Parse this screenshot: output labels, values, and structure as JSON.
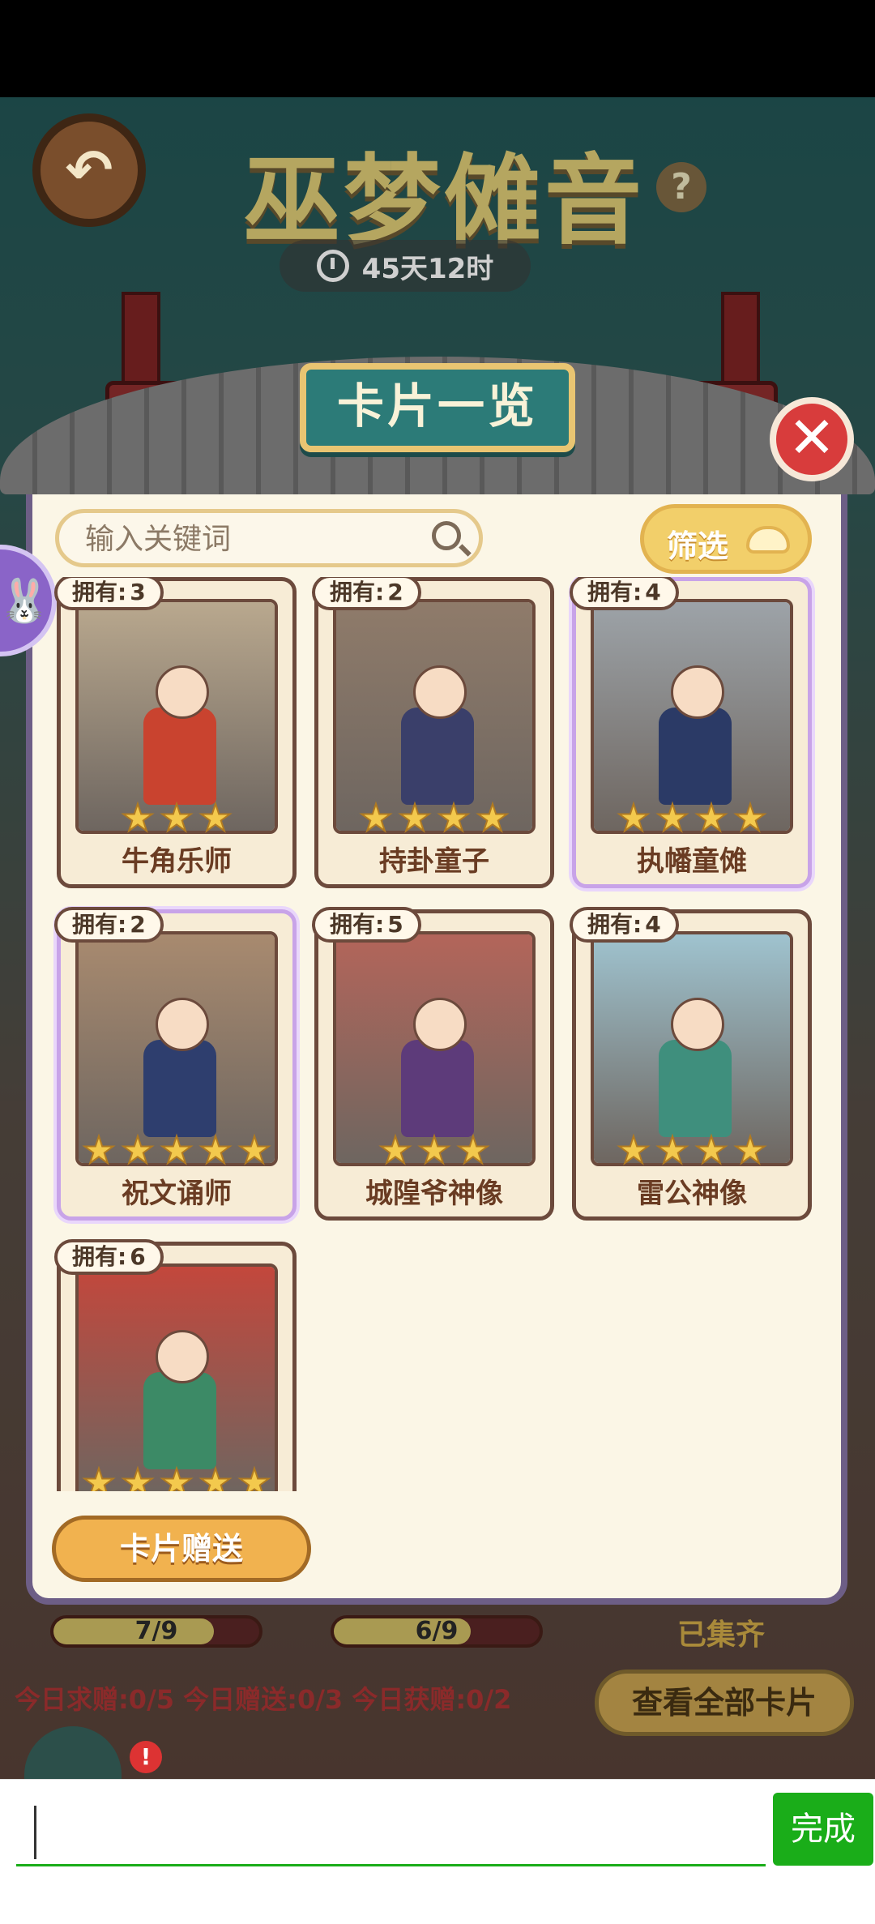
{
  "background": {
    "event_title": "巫梦傩音",
    "timer": "45天12时",
    "help_glyph": "?",
    "progress": [
      {
        "text": "7/9",
        "fraction": 0.778
      },
      {
        "text": "6/9",
        "fraction": 0.667
      }
    ],
    "collected_label": "已集齐",
    "daily_stats": "今日求赠:0/5  今日赠送:0/3  今日获赠:0/2",
    "view_all_label": "查看全部卡片"
  },
  "modal": {
    "title": "卡片一览",
    "close_glyph": "✕",
    "search_placeholder": "输入关键词",
    "filter_label": "筛选",
    "owned_prefix": "拥有:",
    "cards": [
      {
        "owned": "3",
        "name": "牛角乐师",
        "stars": 3,
        "special": false,
        "bg": "#b9a88e",
        "body": "#c9432f"
      },
      {
        "owned": "2",
        "name": "持卦童子",
        "stars": 4,
        "special": false,
        "bg": "#8f7b6a",
        "body": "#3a3f6a"
      },
      {
        "owned": "4",
        "name": "执幡童傩",
        "stars": 4,
        "special": true,
        "bg": "#9da3a8",
        "body": "#2b3a66"
      },
      {
        "owned": "2",
        "name": "祝文诵师",
        "stars": 5,
        "special": true,
        "bg": "#a88a6f",
        "body": "#2e3e6e"
      },
      {
        "owned": "5",
        "name": "城隍爷神像",
        "stars": 3,
        "special": false,
        "bg": "#b3655a",
        "body": "#5d3b7a"
      },
      {
        "owned": "4",
        "name": "雷公神像",
        "stars": 4,
        "special": false,
        "bg": "#9fc3cf",
        "body": "#3f8f7d"
      },
      {
        "owned": "6",
        "name": "",
        "stars": 5,
        "special": false,
        "bg": "#c3473c",
        "body": "#3c8a66"
      }
    ],
    "gift_button_label": "卡片赠送"
  },
  "side_mascot_glyph": "🐰",
  "alert_badge": "!",
  "keyboard_bar": {
    "done_label": "完成",
    "input_value": ""
  }
}
